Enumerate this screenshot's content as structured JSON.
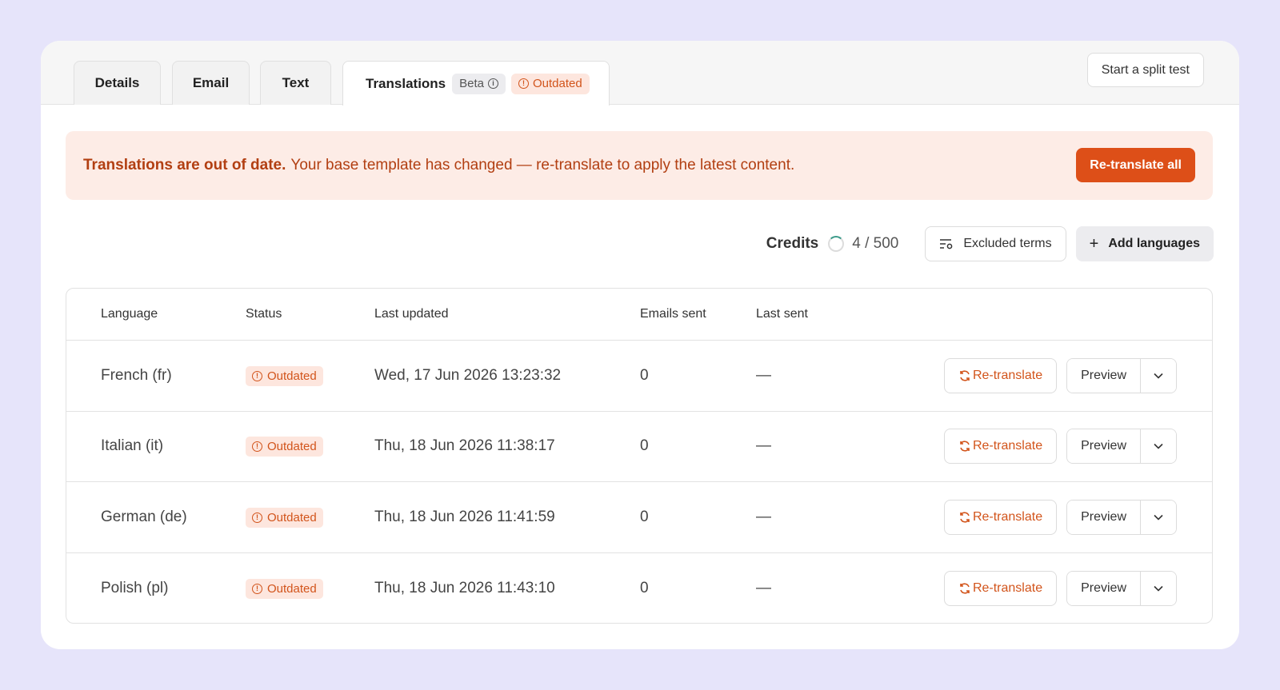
{
  "tabs": {
    "details": "Details",
    "email": "Email",
    "text": "Text",
    "translations": "Translations",
    "beta_tag": "Beta",
    "outdated_tag": "Outdated"
  },
  "header": {
    "split_test_label": "Start a split test"
  },
  "banner": {
    "title": "Translations are out of date.",
    "message": "Your base template has changed — re-translate to apply the latest content.",
    "button_label": "Re-translate all"
  },
  "toolbar": {
    "credits_label": "Credits",
    "credits_value": "4 / 500",
    "excluded_terms_label": "Excluded terms",
    "add_languages_label": "Add languages"
  },
  "table": {
    "columns": [
      "Language",
      "Status",
      "Last updated",
      "Emails sent",
      "Last sent"
    ],
    "rows": [
      {
        "language": "French (fr)",
        "status": "Outdated",
        "last_updated": "Wed, 17 Jun 2026 13:23:32",
        "emails_sent": "0",
        "last_sent": "—",
        "retranslate_label": "Re-translate",
        "preview_label": "Preview"
      },
      {
        "language": "Italian (it)",
        "status": "Outdated",
        "last_updated": "Thu, 18 Jun 2026 11:38:17",
        "emails_sent": "0",
        "last_sent": "—",
        "retranslate_label": "Re-translate",
        "preview_label": "Preview"
      },
      {
        "language": "German (de)",
        "status": "Outdated",
        "last_updated": "Thu, 18 Jun 2026 11:41:59",
        "emails_sent": "0",
        "last_sent": "—",
        "retranslate_label": "Re-translate",
        "preview_label": "Preview"
      },
      {
        "language": "Polish (pl)",
        "status": "Outdated",
        "last_updated": "Thu, 18 Jun 2026 11:43:10",
        "emails_sent": "0",
        "last_sent": "—",
        "retranslate_label": "Re-translate",
        "preview_label": "Preview"
      }
    ]
  },
  "colors": {
    "accent": "#dd4f18",
    "banner_bg": "#fdece6",
    "badge_bg": "#fde6de",
    "page_bg": "#e6e4fa"
  },
  "icons": {
    "info": "info-icon",
    "alert": "alert-circle-icon",
    "spinner": "credits-spinner-icon",
    "filter": "excluded-terms-icon",
    "plus": "plus-icon",
    "refresh": "refresh-icon",
    "chevron": "chevron-down-icon"
  }
}
